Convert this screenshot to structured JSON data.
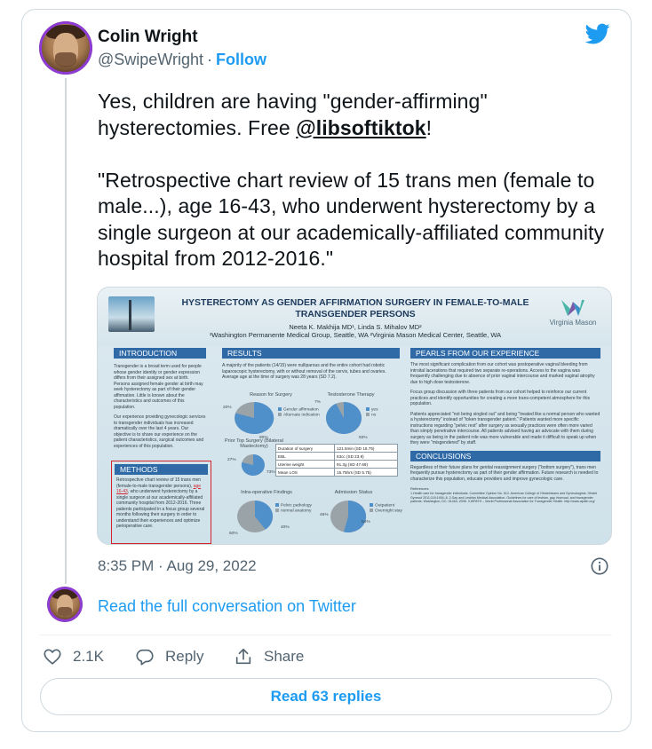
{
  "tweet": {
    "author_name": "Colin Wright",
    "handle": "@SwipeWright",
    "separator": "·",
    "follow_label": "Follow",
    "text_line1_a": "Yes, children are having \"gender-affirming\" hysterectomies. Free ",
    "mention": "@libsoftiktok",
    "text_line1_b": "!",
    "quote": "\"Retrospective chart review of 15 trans men (female to male...), age 16-43, who underwent hysterectomy by a single surgeon at our academically-affiliated community hospital from 2012-2016.\"",
    "timestamp": "8:35 PM · Aug 29, 2022",
    "read_conversation": "Read the full conversation on Twitter",
    "likes_count": "2.1K",
    "reply_label": "Reply",
    "share_label": "Share",
    "read_replies": "Read 63 replies"
  },
  "icons": {
    "brand": "twitter-bird-icon",
    "info": "info-icon",
    "like": "heart-icon",
    "reply": "reply-bubble-icon",
    "share": "share-upload-icon"
  },
  "colors": {
    "accent": "#1d9bf0",
    "text": "#0f1419",
    "muted": "#536471",
    "border": "#cfd9de",
    "poster_header": "#2f6aa7",
    "methods_highlight": "#d4222a"
  },
  "poster": {
    "title": "HYSTERECTOMY AS GENDER AFFIRMATION SURGERY IN FEMALE-TO-MALE TRANSGENDER PERSONS",
    "authors": "Neeta K. Makhija MD¹, Linda S. Mihalov MD²",
    "affiliations": "¹Washington Permanente Medical Group, Seattle, WA ²Virginia Mason Medical Center, Seattle, WA",
    "logo_text": "Virginia Mason",
    "introduction_head": "INTRODUCTION",
    "introduction_p1": "Transgender is a broad term used for people whose gender identity or gender expression differs from their assigned sex at birth. Persons assigned female gender at birth may seek hysterectomy as part of their gender affirmation. Little is known about the characteristics and outcomes of this population.",
    "introduction_p2": "Our experience providing gynecologic services to transgender individuals has increased dramatically over the last 4 years. Our objective is to share our experience on the patient characteristics, surgical outcomes and experiences of this population.",
    "methods_head": "METHODS",
    "methods_a": "Retrospective chart review of 15 trans men (female-to-male transgender persons), ",
    "methods_age": "age 16-43",
    "methods_b": ", who underwent hysterectomy by a single surgeon at our academically-affiliated community hospital from 2012-2016. Three patients participated in a focus group several months following their surgery in order to understand their experiences and optimize perioperative care.",
    "results_head": "RESULTS",
    "results_text": "A majority of the patients (14/15) were nulliparous and the entire cohort had robotic laparoscopic hysterectomy, with or without removal of the cervix, tubes and ovaries. Average age at the time of surgery was 28 years (SD 7.2).",
    "chart1_title": "Reason for Surgery",
    "chart1_legend": [
      "Gender affirmation",
      "Alternate indication"
    ],
    "chart1_pcts": [
      "20%",
      "80%"
    ],
    "chart2_title": "Testosterone Therapy",
    "chart2_legend": [
      "yes",
      "no"
    ],
    "chart2_pcts": [
      "7%",
      "93%"
    ],
    "chart3_title": "Prior Top Surgery (Bilateral Mastectomy)",
    "chart3_pcts": [
      "27%",
      "73%"
    ],
    "chart4_title": "Intra-operative Findings",
    "chart4_legend": [
      "Pelvic pathology",
      "normal anatomy"
    ],
    "chart4_pcts": [
      "60%",
      "40%"
    ],
    "chart5_title": "Admission Status",
    "chart5_legend": [
      "Outpatient",
      "Overnight stay"
    ],
    "chart5_pcts": [
      "46%",
      "54%"
    ],
    "table": [
      [
        "Duration of surgery",
        "121.5min (SD 18.75)"
      ],
      [
        "EBL",
        "63cc (SD 23.9)"
      ],
      [
        "Uterine weight",
        "91.3g (SD 47.69)"
      ],
      [
        "Mean LOS",
        "15.75hrs (SD 5.75)"
      ]
    ],
    "pearls_head": "PEARLS FROM OUR EXPERIENCE",
    "pearls_p1": "The most significant complication from our cohort was postoperative vaginal bleeding from introital lacerations that required two separate re-operations. Access to the vagina was frequently challenging due to absence of prior vaginal intercourse and marked vaginal atrophy due to high dose testosterone.",
    "pearls_p2": "Focus group discussion with three patients from our cohort helped to reinforce our current practices and identify opportunities for creating a more trans-competent atmosphere for this population.",
    "pearls_p3": "Patients appreciated \"not being singled out\" and being \"treated like a normal person who wanted a hysterectomy\" instead of \"token transgender patient.\" Patients wanted more specific instructions regarding \"pelvic rest\" after surgery as sexually practices were often more varied than simply penetrative intercourse. All patients advised having an advocate with them during surgery as being in the patient role was more vulnerable and made it difficult to speak up when they were \"misgendered\" by staff.",
    "conclusions_head": "CONCLUSIONS",
    "conclusions_text": "Regardless of their future plans for genital reassignment surgery (\"bottom surgery\"), trans men frequently pursue hysterectomy as part of their gender affirmation. Future research is needed to characterize this population, educate providers and improve gynecologic care.",
    "references_head": "References",
    "references_text": "1.Health care for transgender individuals. Committee Opinion No. 512. American College of Obstetricians and Gynecologists. Obstet Gynecol 2011;118:1454–8. 2.Gay and Lesbian Medical Association. Guidelines for care of lesbian, gay, bisexual, and transgender patients. Washington, DC: GLMA; 2006. 3.WPATH – World Professional Association for Transgender Health. http://www.wpath.org/"
  }
}
